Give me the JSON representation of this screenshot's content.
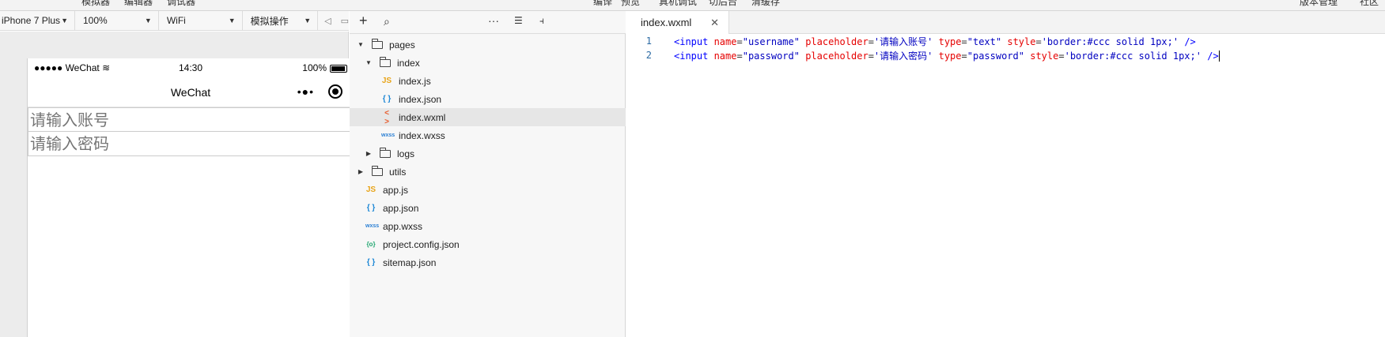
{
  "top_menu": {
    "left": [
      "模拟器",
      "编辑器",
      "调试器"
    ],
    "center": [
      "编译",
      "预览",
      "真机调试",
      "切后台",
      "清缓存"
    ],
    "right": [
      "版本管理",
      "社区"
    ]
  },
  "sim_toolbar": {
    "device": "iPhone 7 Plus",
    "zoom": "100%",
    "network": "WiFi",
    "operation": "模拟操作"
  },
  "phone": {
    "signal": "●●●●● WeChat",
    "time": "14:30",
    "battery": "100%",
    "nav_title": "WeChat",
    "username_placeholder": "请输入账号",
    "password_placeholder": "请输入密码"
  },
  "file_tree": [
    {
      "label": "pages",
      "type": "folder",
      "expanded": true
    },
    {
      "label": "index",
      "type": "folder",
      "expanded": true
    },
    {
      "label": "index.js",
      "type": "js",
      "icon": "JS"
    },
    {
      "label": "index.json",
      "type": "json",
      "icon": "{ }"
    },
    {
      "label": "index.wxml",
      "type": "wxml",
      "icon": "< >",
      "selected": true
    },
    {
      "label": "index.wxss",
      "type": "wxss",
      "icon": "wxss"
    },
    {
      "label": "logs",
      "type": "folder",
      "expanded": false
    },
    {
      "label": "utils",
      "type": "folder",
      "expanded": false
    },
    {
      "label": "app.js",
      "type": "js",
      "icon": "JS"
    },
    {
      "label": "app.json",
      "type": "json",
      "icon": "{ }"
    },
    {
      "label": "app.wxss",
      "type": "wxss",
      "icon": "wxss"
    },
    {
      "label": "project.config.json",
      "type": "config",
      "icon": "{o}"
    },
    {
      "label": "sitemap.json",
      "type": "json",
      "icon": "{ }"
    }
  ],
  "editor": {
    "tab_label": "index.wxml",
    "lines": [
      {
        "number": "1",
        "tokens": [
          {
            "t": "tag",
            "v": "<input "
          },
          {
            "t": "attr",
            "v": "name"
          },
          {
            "t": "plain",
            "v": "="
          },
          {
            "t": "str",
            "v": "\"username\""
          },
          {
            "t": "plain",
            "v": " "
          },
          {
            "t": "attr",
            "v": "placeholder"
          },
          {
            "t": "plain",
            "v": "="
          },
          {
            "t": "str",
            "v": "'请输入账号'"
          },
          {
            "t": "plain",
            "v": " "
          },
          {
            "t": "attr",
            "v": "type"
          },
          {
            "t": "plain",
            "v": "="
          },
          {
            "t": "str",
            "v": "\"text\""
          },
          {
            "t": "plain",
            "v": " "
          },
          {
            "t": "attr",
            "v": "style"
          },
          {
            "t": "plain",
            "v": "="
          },
          {
            "t": "str",
            "v": "'border:#ccc solid 1px;'"
          },
          {
            "t": "plain",
            "v": " "
          },
          {
            "t": "tag",
            "v": "/>"
          }
        ]
      },
      {
        "number": "2",
        "tokens": [
          {
            "t": "tag",
            "v": "<input "
          },
          {
            "t": "attr",
            "v": "name"
          },
          {
            "t": "plain",
            "v": "="
          },
          {
            "t": "str",
            "v": "\"password\""
          },
          {
            "t": "plain",
            "v": " "
          },
          {
            "t": "attr",
            "v": "placeholder"
          },
          {
            "t": "plain",
            "v": "="
          },
          {
            "t": "str",
            "v": "'请输入密码'"
          },
          {
            "t": "plain",
            "v": " "
          },
          {
            "t": "attr",
            "v": "type"
          },
          {
            "t": "plain",
            "v": "="
          },
          {
            "t": "str",
            "v": "\"password\""
          },
          {
            "t": "plain",
            "v": " "
          },
          {
            "t": "attr",
            "v": "style"
          },
          {
            "t": "plain",
            "v": "="
          },
          {
            "t": "str",
            "v": "'border:#ccc solid 1px;'"
          },
          {
            "t": "plain",
            "v": " "
          },
          {
            "t": "tag",
            "v": "/>"
          }
        ]
      }
    ]
  }
}
